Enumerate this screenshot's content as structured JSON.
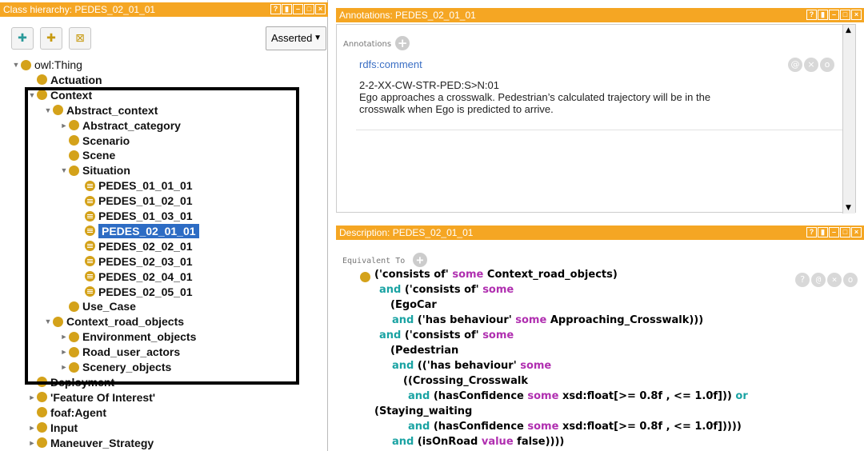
{
  "left_panel": {
    "title": "Class hierarchy: PEDES_02_01_01",
    "toolbar": {
      "dropdown": "Asserted"
    },
    "tree": [
      {
        "label": "owl:Thing",
        "bold": false,
        "twisty": "▼",
        "indent": 0,
        "icon": "class"
      },
      {
        "label": "Actuation",
        "bold": true,
        "twisty": "",
        "indent": 1,
        "icon": "class"
      },
      {
        "label": "Context",
        "bold": true,
        "twisty": "▼",
        "indent": 1,
        "icon": "class"
      },
      {
        "label": "Abstract_context",
        "bold": true,
        "twisty": "▼",
        "indent": 2,
        "icon": "class"
      },
      {
        "label": "Abstract_category",
        "bold": true,
        "twisty": "►",
        "indent": 3,
        "icon": "class"
      },
      {
        "label": "Scenario",
        "bold": true,
        "twisty": "",
        "indent": 3,
        "icon": "class"
      },
      {
        "label": "Scene",
        "bold": true,
        "twisty": "",
        "indent": 3,
        "icon": "class"
      },
      {
        "label": "Situation",
        "bold": true,
        "twisty": "▼",
        "indent": 3,
        "icon": "class"
      },
      {
        "label": "PEDES_01_01_01",
        "bold": true,
        "twisty": "",
        "indent": 4,
        "icon": "individual"
      },
      {
        "label": "PEDES_01_02_01",
        "bold": true,
        "twisty": "",
        "indent": 4,
        "icon": "individual"
      },
      {
        "label": "PEDES_01_03_01",
        "bold": true,
        "twisty": "",
        "indent": 4,
        "icon": "individual"
      },
      {
        "label": "PEDES_02_01_01",
        "bold": true,
        "twisty": "",
        "indent": 4,
        "icon": "individual",
        "selected": true
      },
      {
        "label": "PEDES_02_02_01",
        "bold": true,
        "twisty": "",
        "indent": 4,
        "icon": "individual"
      },
      {
        "label": "PEDES_02_03_01",
        "bold": true,
        "twisty": "",
        "indent": 4,
        "icon": "individual"
      },
      {
        "label": "PEDES_02_04_01",
        "bold": true,
        "twisty": "",
        "indent": 4,
        "icon": "individual"
      },
      {
        "label": "PEDES_02_05_01",
        "bold": true,
        "twisty": "",
        "indent": 4,
        "icon": "individual"
      },
      {
        "label": "Use_Case",
        "bold": true,
        "twisty": "",
        "indent": 3,
        "icon": "class"
      },
      {
        "label": "Context_road_objects",
        "bold": true,
        "twisty": "▼",
        "indent": 2,
        "icon": "class"
      },
      {
        "label": "Environment_objects",
        "bold": true,
        "twisty": "►",
        "indent": 3,
        "icon": "class"
      },
      {
        "label": "Road_user_actors",
        "bold": true,
        "twisty": "►",
        "indent": 3,
        "icon": "class"
      },
      {
        "label": "Scenery_objects",
        "bold": true,
        "twisty": "►",
        "indent": 3,
        "icon": "class"
      },
      {
        "label": "Deployment",
        "bold": true,
        "twisty": "",
        "indent": 1,
        "icon": "class"
      },
      {
        "label": "'Feature Of Interest'",
        "bold": true,
        "twisty": "►",
        "indent": 1,
        "icon": "class"
      },
      {
        "label": "foaf:Agent",
        "bold": true,
        "twisty": "",
        "indent": 1,
        "icon": "class"
      },
      {
        "label": "Input",
        "bold": true,
        "twisty": "►",
        "indent": 1,
        "icon": "class"
      },
      {
        "label": "Maneuver_Strategy",
        "bold": true,
        "twisty": "►",
        "indent": 1,
        "icon": "class"
      }
    ]
  },
  "annotations": {
    "title": "Annotations: PEDES_02_01_01",
    "header": "Annotations",
    "property": "rdfs:comment",
    "lines": [
      "2-2-XX-CW-STR-PED:S>N:01",
      "Ego approaches a crosswalk. Pedestrian’s calculated trajectory will be in the",
      "crosswalk when Ego is predicted to arrive."
    ]
  },
  "description": {
    "title": "Description: PEDES_02_01_01",
    "header": "Equivalent To",
    "lines": [
      [
        {
          "t": "('consists of' ",
          "c": ""
        },
        {
          "t": "some",
          "c": "p"
        },
        {
          "t": " Context_road_objects)",
          "c": ""
        }
      ],
      [
        {
          "t": "and",
          "c": "c"
        },
        {
          "t": " ('consists of' ",
          "c": ""
        },
        {
          "t": "some",
          "c": "p"
        }
      ],
      [
        {
          "t": "(EgoCar",
          "c": ""
        }
      ],
      [
        {
          "t": "and",
          "c": "c"
        },
        {
          "t": " ('has behaviour' ",
          "c": ""
        },
        {
          "t": "some",
          "c": "p"
        },
        {
          "t": " Approaching_Crosswalk)))",
          "c": ""
        }
      ],
      [
        {
          "t": "and",
          "c": "c"
        },
        {
          "t": " ('consists of' ",
          "c": ""
        },
        {
          "t": "some",
          "c": "p"
        }
      ],
      [
        {
          "t": "(Pedestrian",
          "c": ""
        }
      ],
      [
        {
          "t": "and",
          "c": "c"
        },
        {
          "t": " (('has behaviour' ",
          "c": ""
        },
        {
          "t": "some",
          "c": "p"
        }
      ],
      [
        {
          "t": "((Crossing_Crosswalk",
          "c": ""
        }
      ],
      [
        {
          "t": "and",
          "c": "c"
        },
        {
          "t": " (hasConfidence ",
          "c": ""
        },
        {
          "t": "some",
          "c": "p"
        },
        {
          "t": " xsd:float[>= 0.8f , <= 1.0f])) ",
          "c": ""
        },
        {
          "t": "or",
          "c": "c"
        }
      ],
      [
        {
          "t": "(Staying_waiting",
          "c": ""
        }
      ],
      [
        {
          "t": "and",
          "c": "c"
        },
        {
          "t": " (hasConfidence ",
          "c": ""
        },
        {
          "t": "some",
          "c": "p"
        },
        {
          "t": " xsd:float[>= 0.8f , <= 1.0f]))))",
          "c": ""
        }
      ],
      [
        {
          "t": "and",
          "c": "c"
        },
        {
          "t": " (isOnRoad ",
          "c": ""
        },
        {
          "t": "value",
          "c": "p"
        },
        {
          "t": " false))))",
          "c": ""
        }
      ]
    ]
  }
}
